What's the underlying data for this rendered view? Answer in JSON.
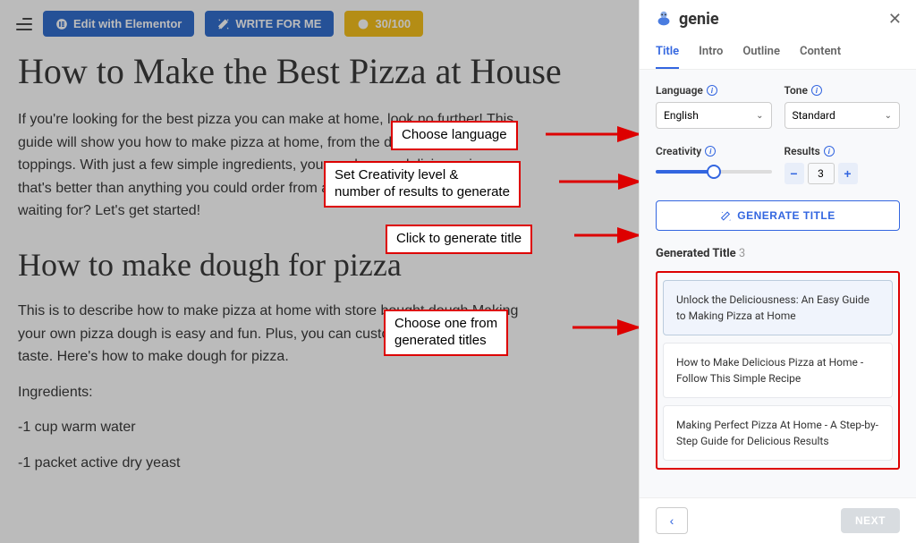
{
  "toolbar": {
    "elementor_label": "Edit with Elementor",
    "write_label": "WRITE FOR ME",
    "score_label": "30/100"
  },
  "content": {
    "h1": "How to Make the Best Pizza at House",
    "p1": "If you're looking for the best pizza you can make at home, look no further! This guide will show you how to make pizza at home, from the dough to the toppings. With just a few simple ingredients, you can have a delicious pizza that's better than anything you could order from a restaurant. So what are you waiting for? Let's get started!",
    "h2": "How to make dough for pizza",
    "p2": "This is to describe how to make pizza at home with store bought dough Making your own pizza dough is easy and fun. Plus, you can customize it to your own taste. Here's how to make dough for pizza.",
    "p3": "Ingredients:",
    "p4": "-1 cup warm water",
    "p5": "-1 packet active dry yeast"
  },
  "annotations": {
    "a1": "Choose language",
    "a2_l1": "Set Creativity level &",
    "a2_l2": "number of results to generate",
    "a3": "Click to generate title",
    "a4_l1": "Choose one from",
    "a4_l2": "generated titles"
  },
  "sidebar": {
    "brand": "genie",
    "tabs": [
      "Title",
      "Intro",
      "Outline",
      "Content"
    ],
    "language_label": "Language",
    "language_value": "English",
    "tone_label": "Tone",
    "tone_value": "Standard",
    "creativity_label": "Creativity",
    "results_label": "Results",
    "results_value": "3",
    "generate_label": "GENERATE TITLE",
    "generated_heading": "Generated Title",
    "generated_count": "3",
    "titles": [
      "Unlock the Deliciousness: An Easy Guide to Making Pizza at Home",
      "How to Make Delicious Pizza at Home - Follow This Simple Recipe",
      "Making Perfect Pizza At Home - A Step-by-Step Guide for Delicious Results"
    ],
    "next_label": "NEXT"
  }
}
